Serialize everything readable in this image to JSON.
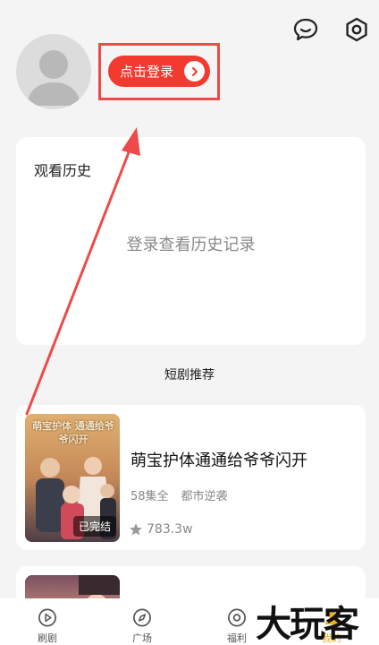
{
  "header": {
    "message_icon": "chat-bubble-icon",
    "settings_icon": "gear-icon"
  },
  "profile": {
    "login_label": "点击登录",
    "highlight_color": "#ee4a4a",
    "button_color": "#f23a2f"
  },
  "history": {
    "title": "观看历史",
    "empty_text": "登录查看历史记录"
  },
  "recommend": {
    "section_title": "短剧推荐",
    "items": [
      {
        "title": "萌宝护体通通给爷爷闪开",
        "episodes": "58集全",
        "genre": "都市逆袭",
        "views": "783.3w",
        "badge": "已完结",
        "poster_text": "萌宝护体 通通给爷爷闪开"
      }
    ]
  },
  "nav": {
    "active_color": "#f2b21f",
    "items": [
      {
        "label": "刷剧",
        "icon": "play-circle-icon"
      },
      {
        "label": "广场",
        "icon": "compass-icon"
      },
      {
        "label": "福利",
        "icon": "gift-circle-icon"
      },
      {
        "label": "我的",
        "icon": "user-icon"
      }
    ]
  },
  "watermark": "大玩客"
}
